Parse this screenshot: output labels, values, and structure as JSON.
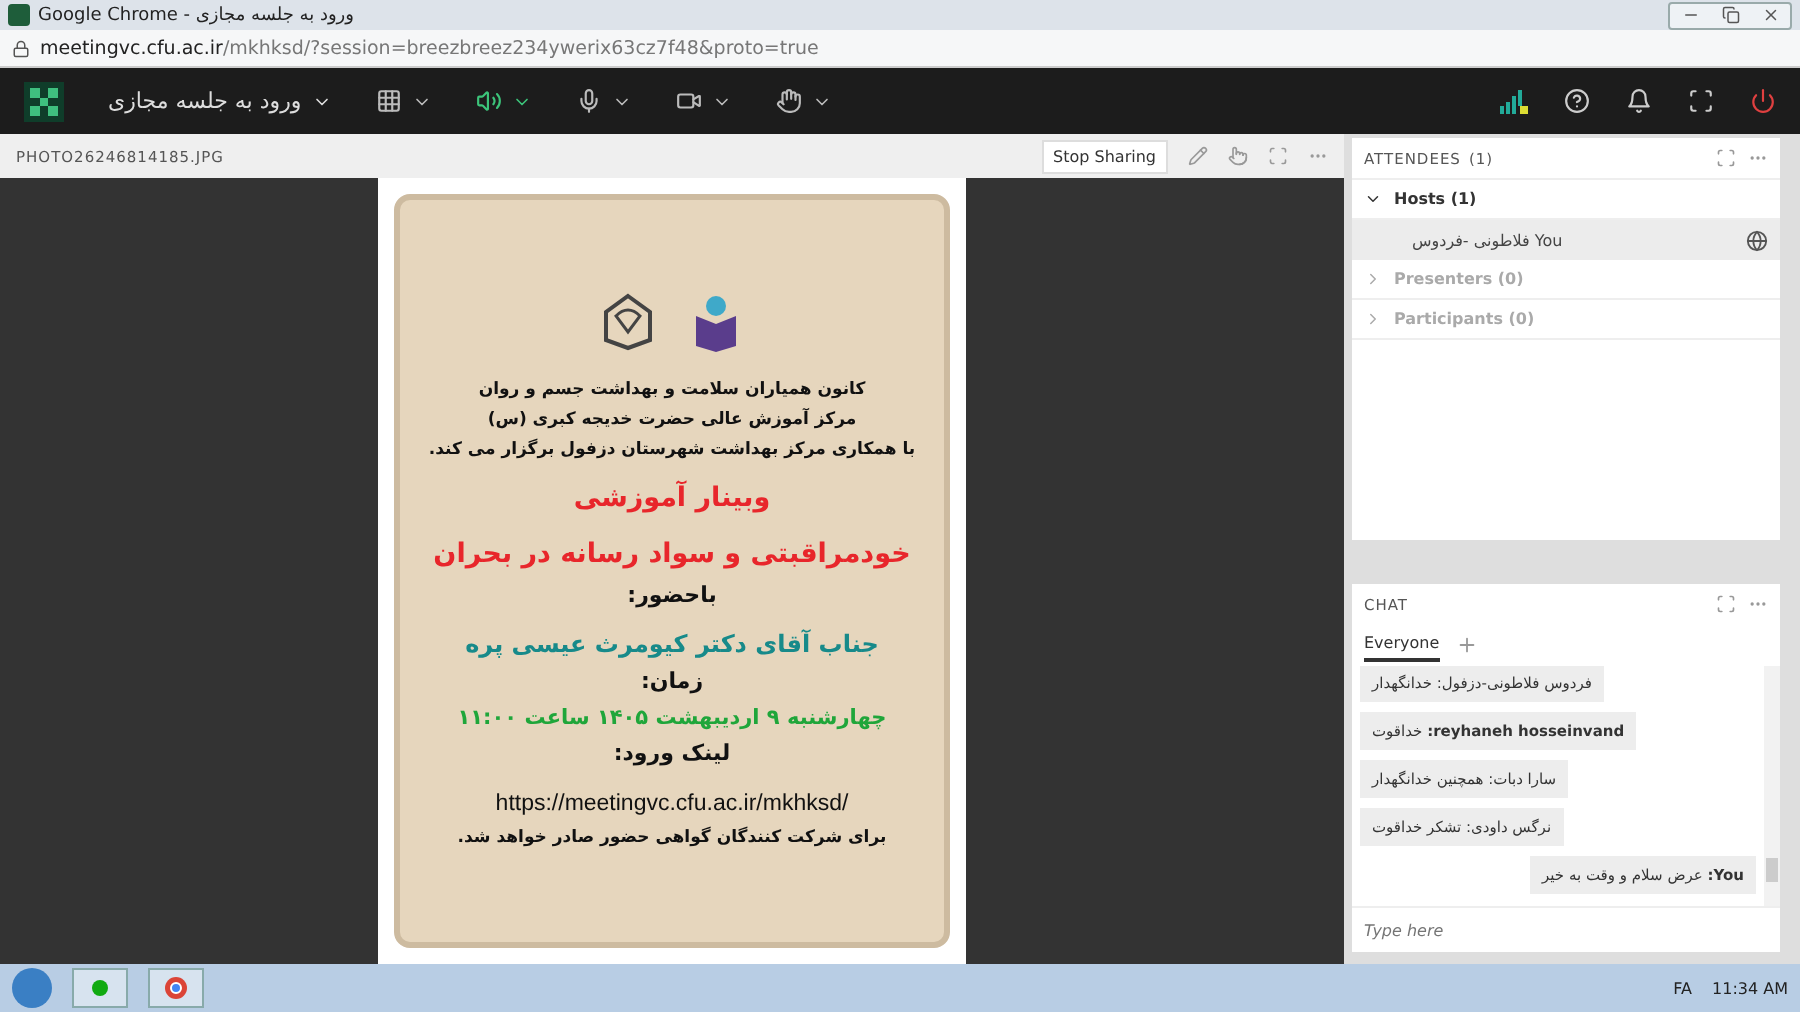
{
  "window": {
    "title": "Google Chrome - ورود به جلسه مجازی"
  },
  "address_bar": {
    "url_host": "meetingvc.cfu.ac.ir",
    "url_path": "/mkhksd/?session=breezbreez234ywerix63cz7f48&proto=true"
  },
  "toolbar": {
    "meeting_menu": "ورود به جلسه مجازی"
  },
  "share_pod": {
    "filename": "PHOTO26246814185.JPG",
    "stop_button": "Stop Sharing",
    "poster": [
      {
        "kind": "body",
        "text": "کانون همیاران سلامت و بهداشت جسم و روان"
      },
      {
        "kind": "body",
        "text": "مرکز آموزش عالی حضرت خدیجه کبری (س)"
      },
      {
        "kind": "body",
        "text": "با همکاری مرکز بهداشت شهرستان دزفول برگزار می کند."
      },
      {
        "kind": "title",
        "text": "وبینار آموزشی"
      },
      {
        "kind": "title",
        "text": "خودمراقبتی و سواد رسانه در بحران"
      },
      {
        "kind": "label",
        "text": "باحضور:"
      },
      {
        "kind": "name",
        "text": "جناب آقای دکتر کیومرث عیسی پره"
      },
      {
        "kind": "label",
        "text": "زمان:"
      },
      {
        "kind": "date",
        "text": "چهارشنبه ۹ اردیبهشت ۱۴۰۵ ساعت ۱۱:۰۰"
      },
      {
        "kind": "label",
        "text": "لینک ورود:"
      },
      {
        "kind": "link",
        "text": "https://meetingvc.cfu.ac.ir/mkhksd/"
      },
      {
        "kind": "body",
        "text": "برای شرکت کنندگان گواهی حضور صادر خواهد شد."
      }
    ]
  },
  "attendees": {
    "title": "ATTENDEES",
    "count": "(1)",
    "groups": [
      {
        "label": "Hosts (1)",
        "expanded": true,
        "members": [
          "فلاطونی -فردوس You"
        ]
      },
      {
        "label": "Presenters (0)",
        "expanded": false
      },
      {
        "label": "Participants (0)",
        "expanded": false
      }
    ]
  },
  "chat": {
    "title": "CHAT",
    "tabs": [
      {
        "label": "Everyone",
        "selected": true
      }
    ],
    "messages": [
      {
        "text": "فردوس فلاطونی-دزفول: خدانگهدار",
        "own": false
      },
      {
        "text": "**reyhaneh hosseinvand:** خداقوت",
        "own": false
      },
      {
        "text": "سارا دبات: همچنین خدانگهدار",
        "own": false
      },
      {
        "text": "نرگس داودی: تشکر خداقوت",
        "own": false
      },
      {
        "text": "**You:** عرض سلام و وقت به خیر",
        "own": true
      }
    ],
    "placeholder": "Type here"
  },
  "taskbar": {
    "language": "FA",
    "time": "11:34 AM"
  }
}
